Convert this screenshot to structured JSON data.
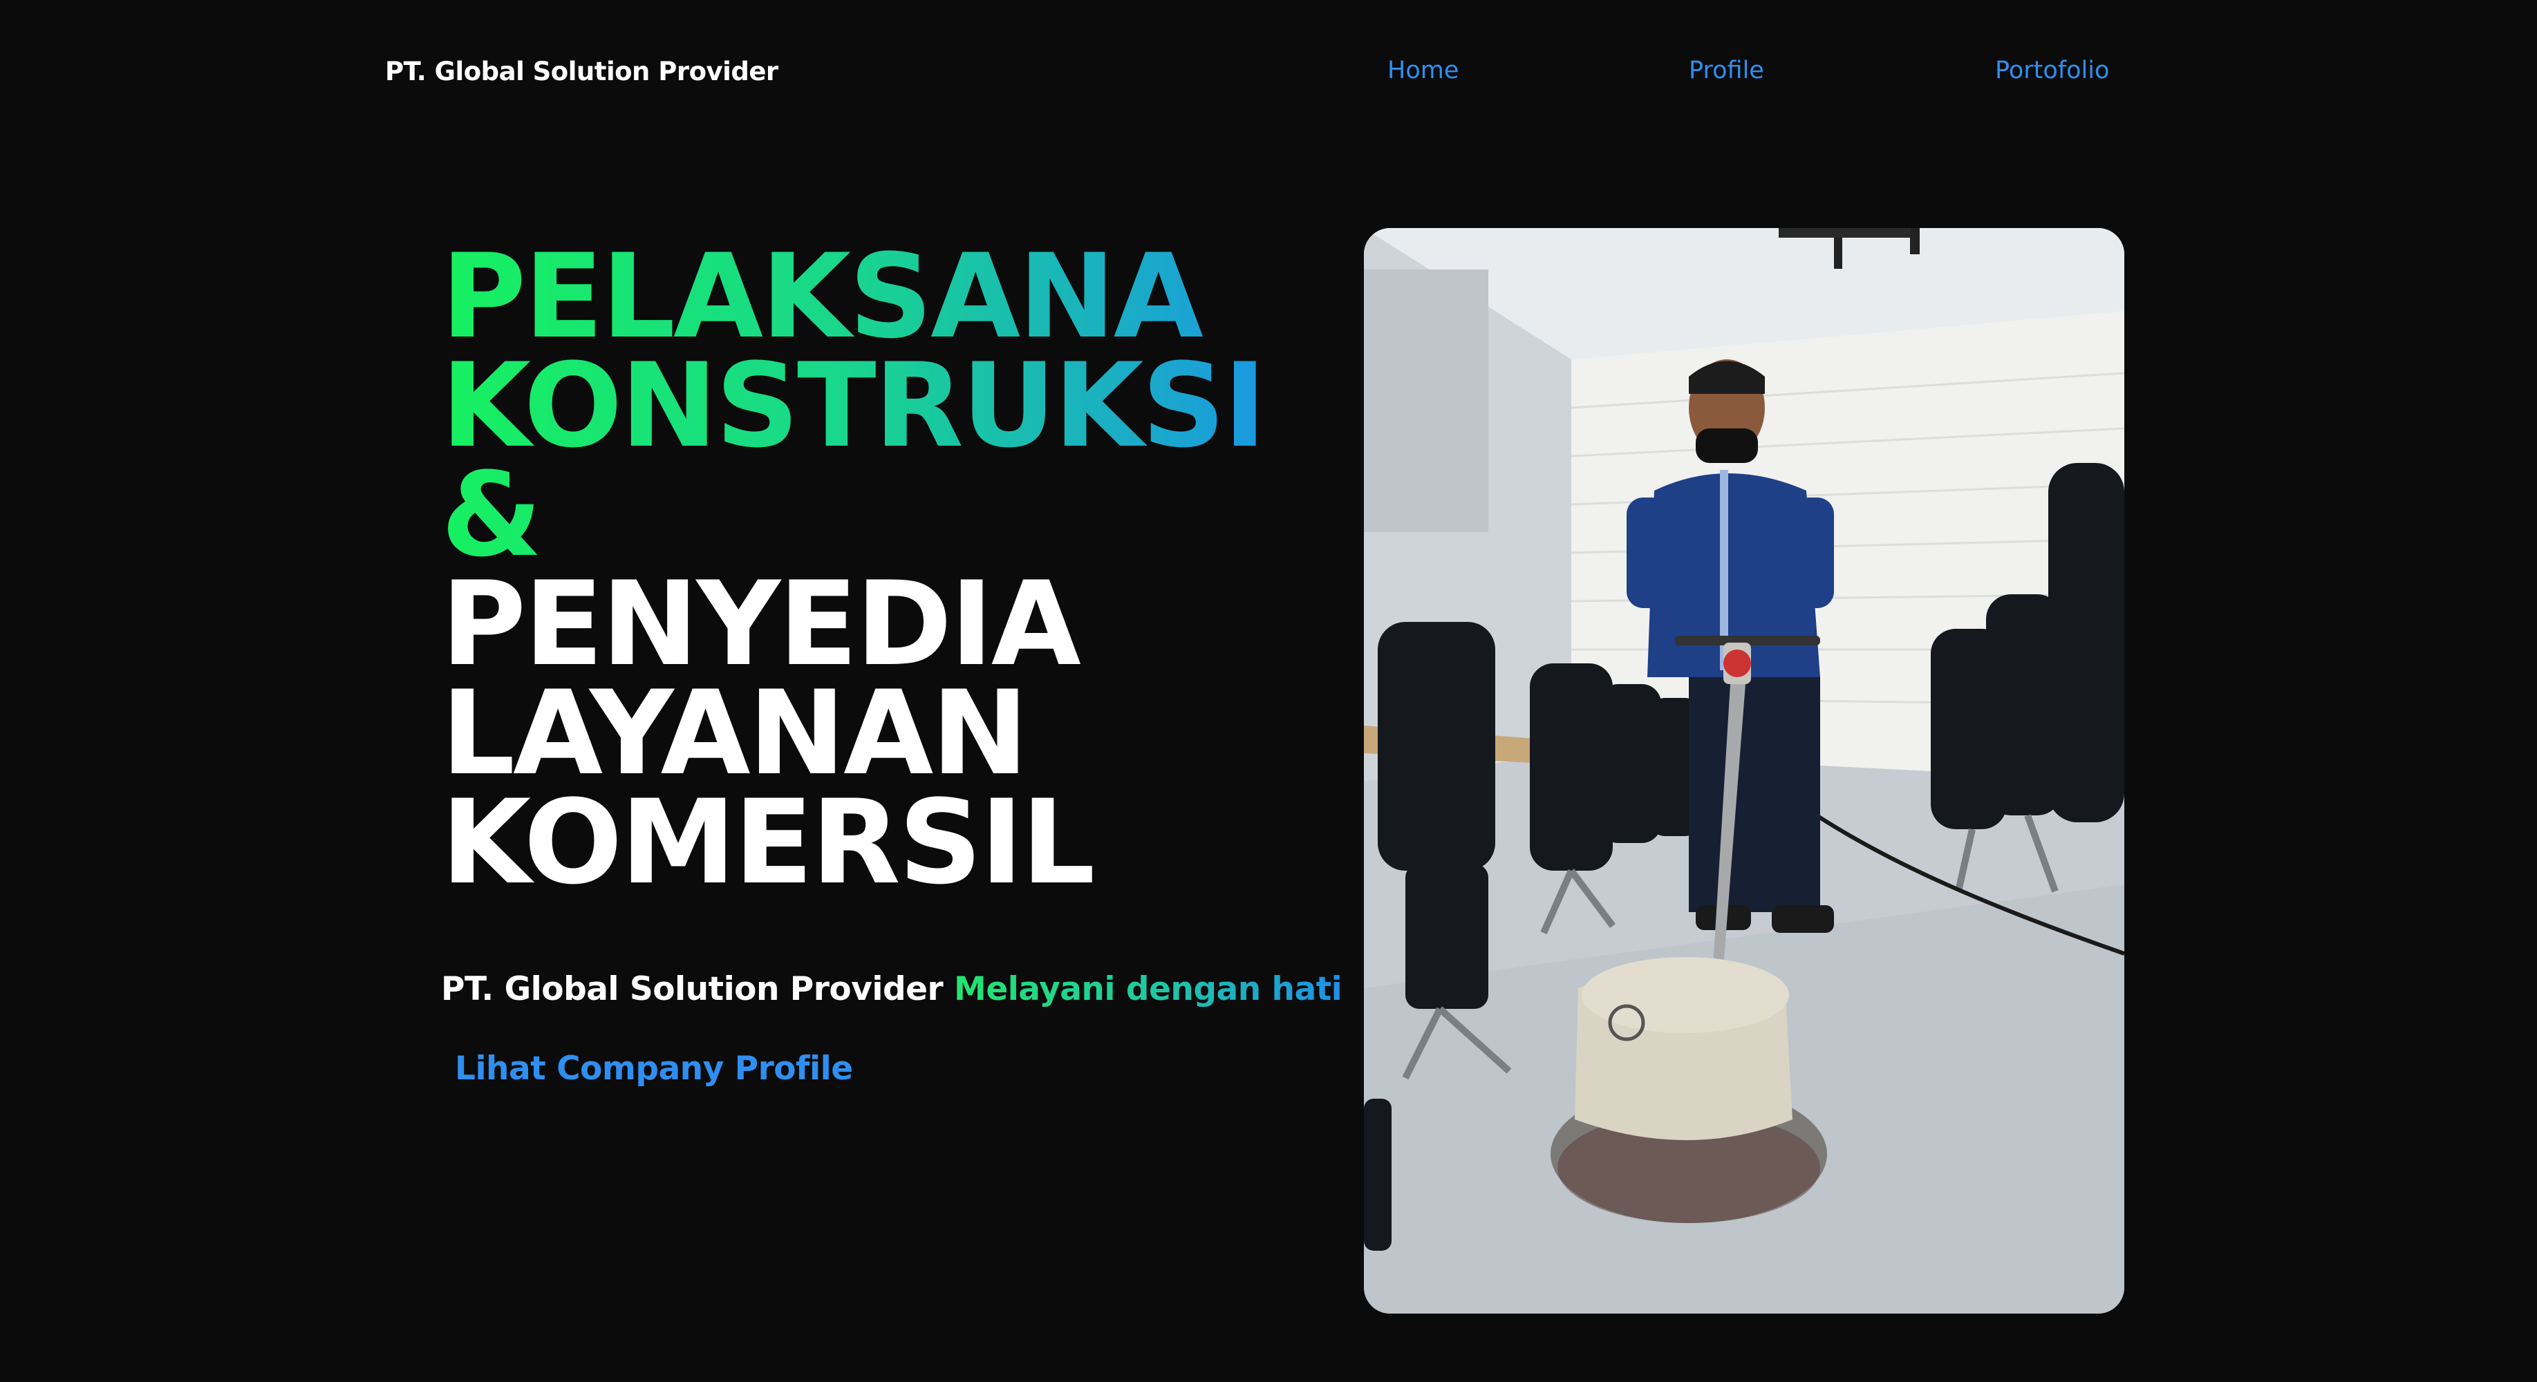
{
  "header": {
    "brand": "PT. Global Solution Provider",
    "nav": {
      "home": "Home",
      "profile": "Profile",
      "portfolio": "Portofolio"
    }
  },
  "hero": {
    "headline_lines": {
      "l1": "PELAKSANA",
      "l2": "KONSTRUKSI",
      "l3": "&",
      "l4": "PENYEDIA",
      "l5": "LAYANAN",
      "l6": "KOMERSIL"
    },
    "tagline_name": "PT. Global Solution Provider",
    "tagline_motto": "Melayani dengan hati",
    "cta_label": "Lihat Company Profile"
  },
  "colors": {
    "background": "#0b0b0c",
    "accent_green": "#17f060",
    "accent_blue": "#2f8ff0"
  }
}
